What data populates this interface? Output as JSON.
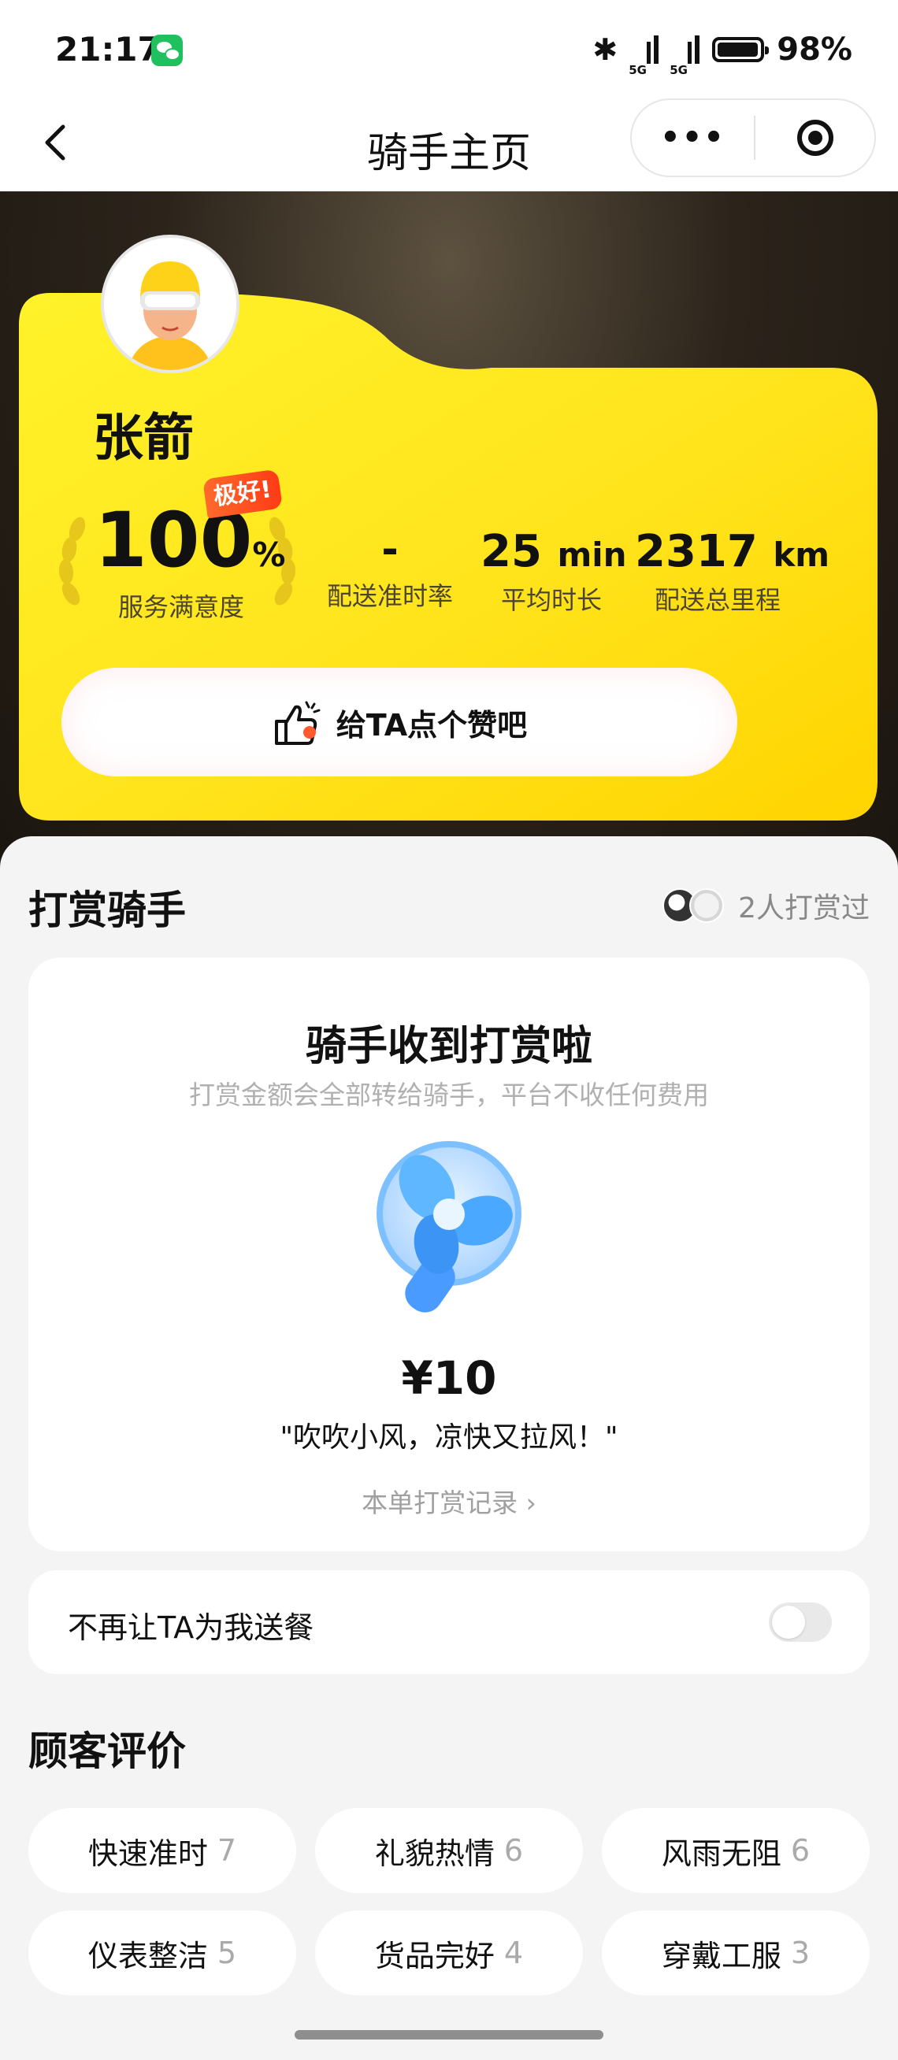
{
  "status_bar": {
    "time": "21:17",
    "network_1": "5G",
    "network_2": "5G",
    "battery": "98%",
    "battery_level": 0.98,
    "icons": [
      "wechat-icon",
      "bluetooth-icon",
      "signal-icon",
      "battery-icon"
    ]
  },
  "nav": {
    "title": "骑手主页",
    "back_icon": "‹",
    "more_icon": "•••"
  },
  "rider": {
    "name": "张箭",
    "badge": "极好!",
    "stats": [
      {
        "value": "100",
        "unit": "%",
        "label": "服务满意度"
      },
      {
        "value": "-",
        "unit": "",
        "label": "配送准时率"
      },
      {
        "value": "25",
        "unit": "min",
        "label": "平均时长"
      },
      {
        "value": "2317",
        "unit": "km",
        "label": "配送总里程"
      }
    ],
    "like_button": "给TA点个赞吧"
  },
  "tip_section": {
    "title": "打赏骑手",
    "tippers_text": "2人打赏过",
    "card_title": "骑手收到打赏啦",
    "card_subtitle": "打赏金额会全部转给骑手，平台不收任何费用",
    "amount": "¥10",
    "message": "\"吹吹小风，凉快又拉风！\"",
    "record_link": "本单打赏记录 ›"
  },
  "block_setting": {
    "label": "不再让TA为我送餐",
    "enabled": false
  },
  "reviews": {
    "title": "顾客评价",
    "tags": [
      {
        "label": "快速准时",
        "count": "7"
      },
      {
        "label": "礼貌热情",
        "count": "6"
      },
      {
        "label": "风雨无阻",
        "count": "6"
      },
      {
        "label": "仪表整洁",
        "count": "5"
      },
      {
        "label": "货品完好",
        "count": "4"
      },
      {
        "label": "穿戴工服",
        "count": "3"
      }
    ]
  },
  "colors": {
    "brand_yellow": "#ffde1f",
    "badge_orange": "#ff4a1c",
    "fan_blue": "#4aa8ff"
  }
}
